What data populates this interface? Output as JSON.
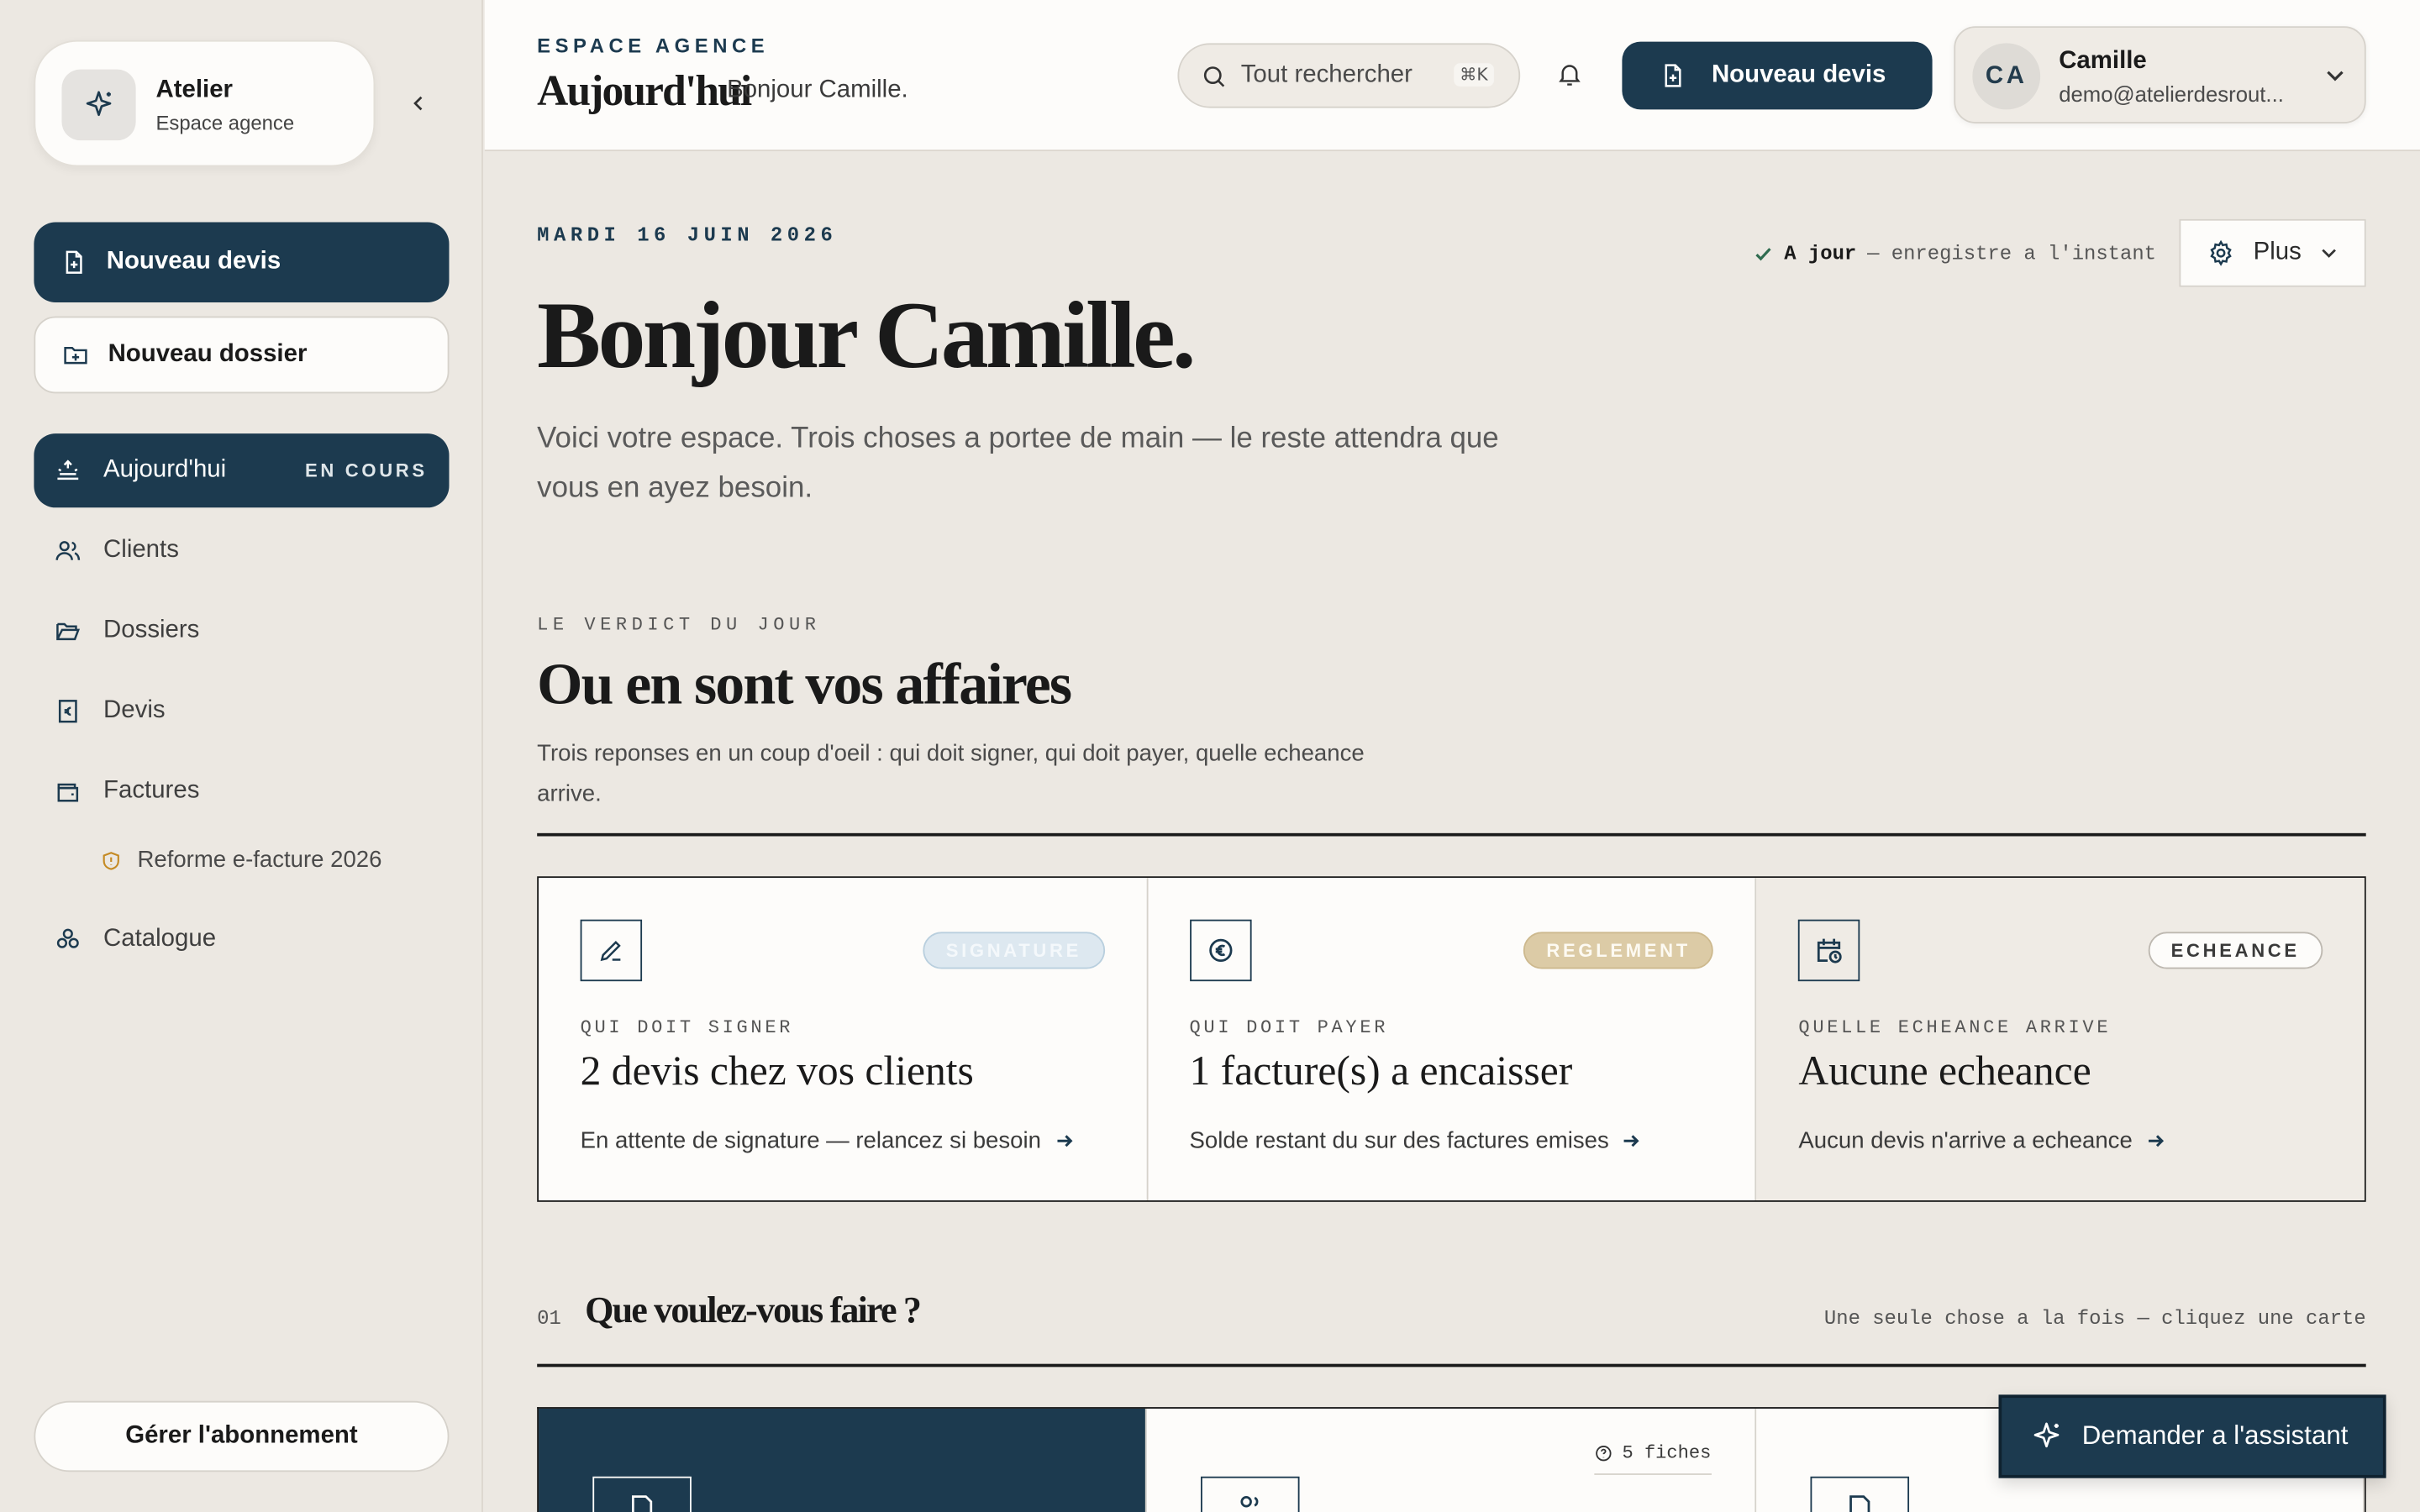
{
  "sidebar": {
    "brand_title": "Atelier",
    "brand_subtitle": "Espace agence",
    "new_quote": "Nouveau devis",
    "new_folder": "Nouveau dossier",
    "nav": {
      "today": "Aujourd'hui",
      "today_badge": "EN COURS",
      "clients": "Clients",
      "folders": "Dossiers",
      "quotes": "Devis",
      "invoices": "Factures",
      "reform": "Reforme e-facture 2026",
      "catalog": "Catalogue"
    },
    "manage_subscription": "Gérer l'abonnement"
  },
  "topbar": {
    "eyebrow": "ESPACE AGENCE",
    "title": "Aujourd'hui",
    "greeting": "Bonjour Camille.",
    "search_placeholder": "Tout rechercher",
    "search_shortcut": "⌘K",
    "new_quote": "Nouveau devis",
    "user_initials": "CA",
    "user_name": "Camille",
    "user_email": "demo@atelierdesrout..."
  },
  "main": {
    "date": "MARDI 16 JUIN 2026",
    "status_bold": "A jour",
    "status_rest": "— enregistre a l'instant",
    "more": "Plus",
    "hello": "Bonjour Camille.",
    "lead": "Voici votre espace. Trois choses a portee de main — le reste attendra que vous en ayez besoin.",
    "verdict_kicker": "LE VERDICT DU JOUR",
    "verdict_title": "Ou en sont vos affaires",
    "verdict_desc": "Trois reponses en un coup d'oeil : qui doit signer, qui doit payer, quelle echeance arrive.",
    "cards": [
      {
        "pill": "SIGNATURE",
        "kicker": "QUI DOIT SIGNER",
        "title": "2 devis chez vos clients",
        "link": "En attente de signature — relancez si besoin"
      },
      {
        "pill": "REGLEMENT",
        "kicker": "QUI DOIT PAYER",
        "title": "1 facture(s) a encaisser",
        "link": "Solde restant du sur des factures emises"
      },
      {
        "pill": "ECHEANCE",
        "kicker": "QUELLE ECHEANCE ARRIVE",
        "title": "Aucune echeance",
        "link": "Aucun devis n'arrive a echeance"
      }
    ],
    "step_number": "01",
    "step_title": "Que voulez-vous faire ?",
    "step_hint": "Une seule chose a la fois — cliquez une carte",
    "fiches": "5 fiches"
  },
  "assistant": "Demander a l'assistant",
  "colors": {
    "accent": "#1c3a4f",
    "background": "#ece8e2",
    "surface": "#fdfcfa"
  }
}
